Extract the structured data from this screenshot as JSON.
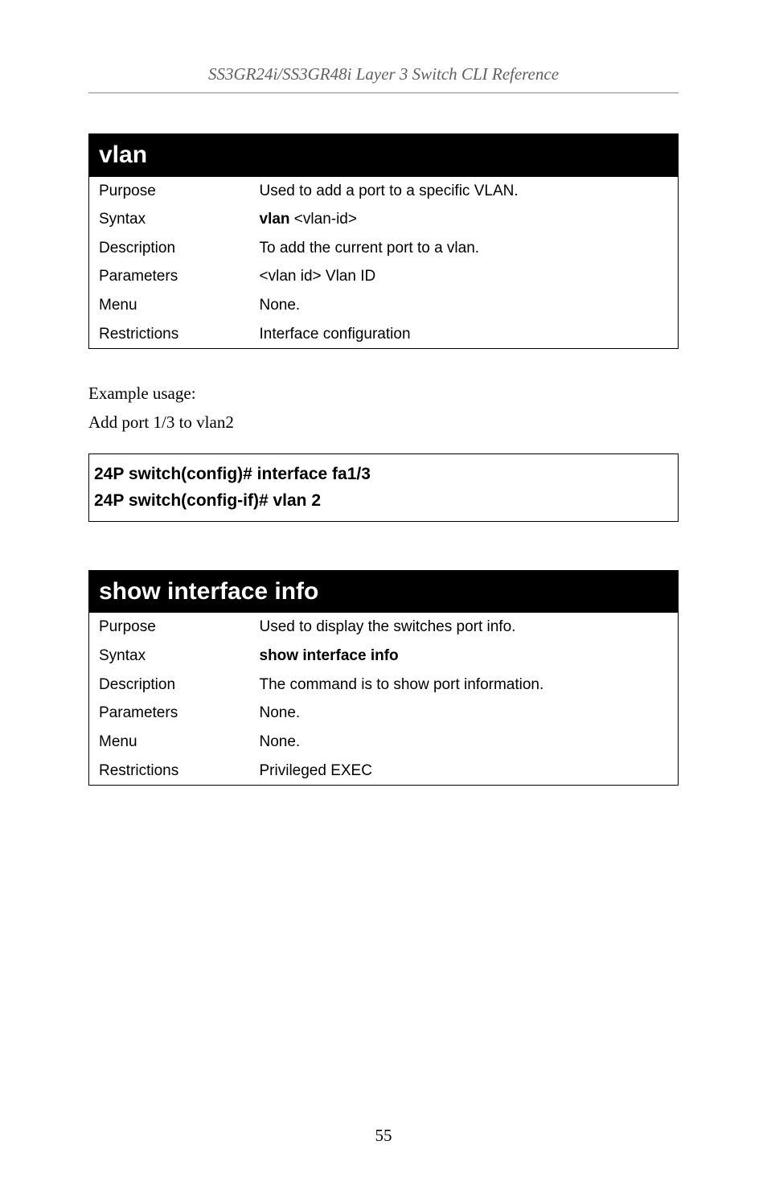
{
  "header": {
    "title": "SS3GR24i/SS3GR48i Layer 3 Switch CLI Reference"
  },
  "table1": {
    "title": "vlan",
    "rows": {
      "purpose_label": "Purpose",
      "purpose_value": "Used to add a port to a specific VLAN.",
      "syntax_label": "Syntax",
      "syntax_bold": "vlan",
      "syntax_rest": " <vlan-id>",
      "description_label": "Description",
      "description_value": "To add the current port to a vlan.",
      "parameters_label": "Parameters",
      "parameters_value": "<vlan id>  Vlan ID",
      "menu_label": "Menu",
      "menu_value": "None.",
      "restrictions_label": "Restrictions",
      "restrictions_value": "Interface configuration"
    }
  },
  "bodytext": {
    "line1": "Example usage:",
    "line2": "Add port 1/3 to vlan2"
  },
  "codebox": {
    "line1": "24P switch(config)# interface fa1/3",
    "line2": "24P switch(config-if)# vlan 2"
  },
  "table2": {
    "title": "show interface info",
    "rows": {
      "purpose_label": "Purpose",
      "purpose_value": "Used to display the switches port info.",
      "syntax_label": "Syntax",
      "syntax_value": "show interface info",
      "description_label": "Description",
      "description_value": "The command is to show port information.",
      "parameters_label": "Parameters",
      "parameters_value": "None.",
      "menu_label": "Menu",
      "menu_value": "None.",
      "restrictions_label": "Restrictions",
      "restrictions_value": "Privileged EXEC"
    }
  },
  "page_number": "55"
}
